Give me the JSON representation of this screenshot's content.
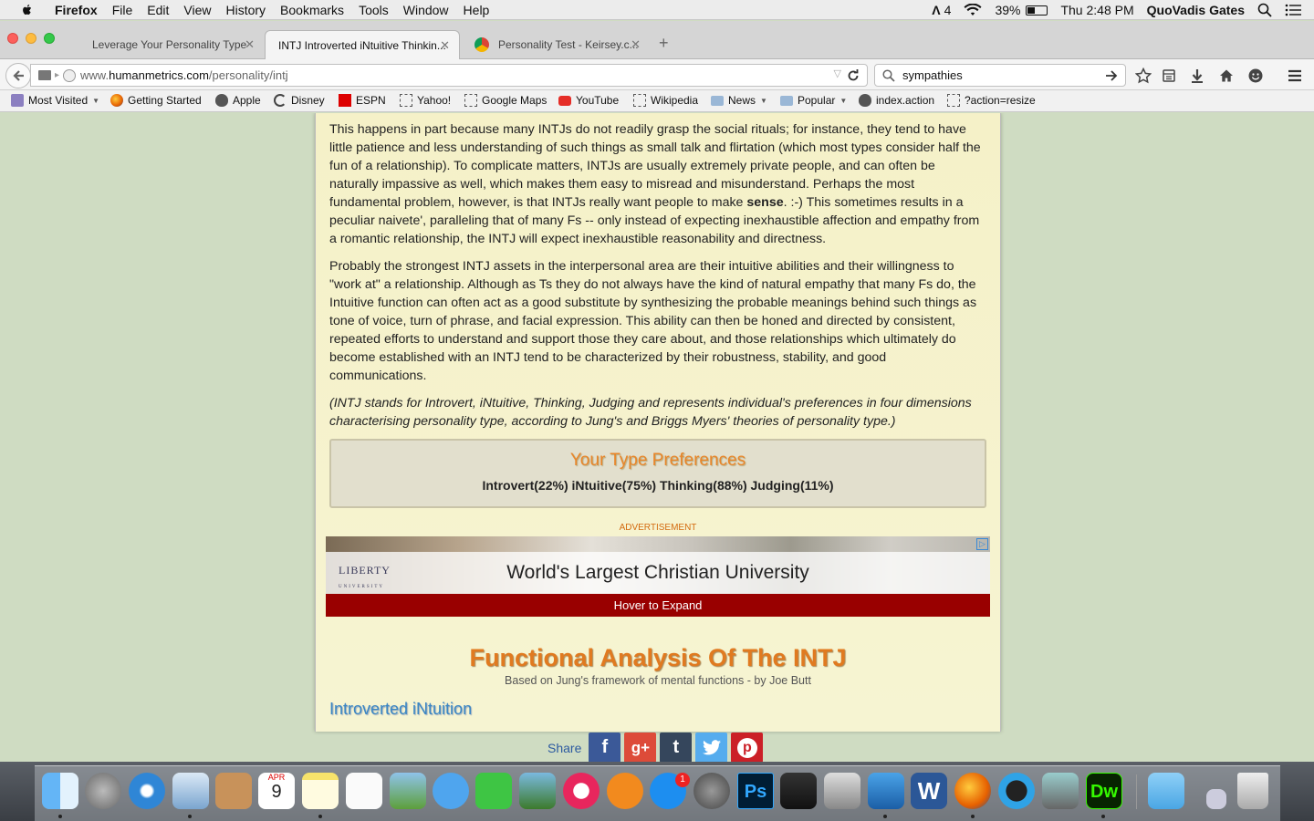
{
  "menubar": {
    "app": "Firefox",
    "items": [
      "File",
      "Edit",
      "View",
      "History",
      "Bookmarks",
      "Tools",
      "Window",
      "Help"
    ],
    "status_num": "4",
    "battery": "39%",
    "clock": "Thu 2:48 PM",
    "user": "QuoVadis Gates"
  },
  "tabs": [
    {
      "title": "Leverage Your Personality Type"
    },
    {
      "title": "INTJ Introverted iNtuitive Thinkin..."
    },
    {
      "title": "Personality Test - Keirsey.c..."
    }
  ],
  "navbar": {
    "url_prefix": "www.",
    "url_domain": "humanmetrics.com",
    "url_path": "/personality/intj",
    "search_value": "sympathies"
  },
  "bookmarks": [
    {
      "label": "Most Visited",
      "icon": "folder-icon",
      "dropdown": true
    },
    {
      "label": "Getting Started",
      "icon": "firefox-icon"
    },
    {
      "label": "Apple",
      "icon": "apple-icon"
    },
    {
      "label": "Disney",
      "icon": "disney-icon"
    },
    {
      "label": "ESPN",
      "icon": "espn-icon"
    },
    {
      "label": "Yahoo!",
      "icon": "page-icon"
    },
    {
      "label": "Google Maps",
      "icon": "page-icon"
    },
    {
      "label": "YouTube",
      "icon": "youtube-icon"
    },
    {
      "label": "Wikipedia",
      "icon": "page-icon"
    },
    {
      "label": "News",
      "icon": "folder-icon",
      "dropdown": true
    },
    {
      "label": "Popular",
      "icon": "folder-icon",
      "dropdown": true
    },
    {
      "label": "index.action",
      "icon": "apple-icon"
    },
    {
      "label": "?action=resize",
      "icon": "page-icon"
    }
  ],
  "article": {
    "para1_a": "This happens in part because many INTJs do not readily grasp the social rituals; for instance, they tend to have little patience and less understanding of such things as small talk and flirtation (which most types consider half the fun of a relationship). To complicate matters, INTJs are usually extremely private people, and can often be naturally impassive as well, which makes them easy to misread and misunderstand. Perhaps the most fundamental problem, however, is that INTJs really want people to make ",
    "para1_bold": "sense",
    "para1_b": ". :-) This sometimes results in a peculiar naivete', paralleling that of many Fs -- only instead of expecting inexhaustible affection and empathy from a romantic relationship, the INTJ will expect inexhaustible reasonability and directness.",
    "para2": "Probably the strongest INTJ assets in the interpersonal area are their intuitive abilities and their willingness to \"work at\" a relationship. Although as Ts they do not always have the kind of natural empathy that many Fs do, the Intuitive function can often act as a good substitute by synthesizing the probable meanings behind such things as tone of voice, turn of phrase, and facial expression. This ability can then be honed and directed by consistent, repeated efforts to understand and support those they care about, and those relationships which ultimately do become established with an INTJ tend to be characterized by their robustness, stability, and good communications.",
    "para3": "(INTJ stands for Introvert, iNtuitive, Thinking, Judging and represents individual's preferences in four dimensions characterising personality type, according to Jung's and Briggs Myers' theories of personality type.)"
  },
  "preferences": {
    "title": "Your Type Preferences",
    "values": "Introvert(22%) iNtuitive(75%) Thinking(88%) Judging(11%)"
  },
  "ad": {
    "label": "ADVERTISEMENT",
    "logo": "LIBERTY",
    "logo_sub": "UNIVERSITY",
    "headline": "World's Largest Christian University",
    "cta": "Hover to Expand"
  },
  "functional": {
    "title": "Functional Analysis Of The INTJ",
    "subtitle": "Based on Jung's framework of mental functions - by Joe Butt",
    "section": "Introverted iNtuition"
  },
  "share": {
    "label": "Share",
    "buttons": [
      {
        "name": "facebook",
        "glyph": "f",
        "color": "#3b5998"
      },
      {
        "name": "google-plus",
        "glyph": "g+",
        "color": "#dd4b39"
      },
      {
        "name": "tumblr",
        "glyph": "t",
        "color": "#35465c"
      },
      {
        "name": "twitter",
        "glyph": "t",
        "color": "#55acee"
      },
      {
        "name": "pinterest",
        "glyph": "p",
        "color": "#cb2027"
      }
    ]
  },
  "dock": {
    "calendar_month": "APR",
    "calendar_day": "9",
    "appstore_badge": "1",
    "ps_label": "Ps",
    "dw_label": "Dw"
  },
  "colors": {
    "accent_orange": "#e07a20",
    "link_blue": "#3a86c4",
    "ad_red": "#990000"
  }
}
